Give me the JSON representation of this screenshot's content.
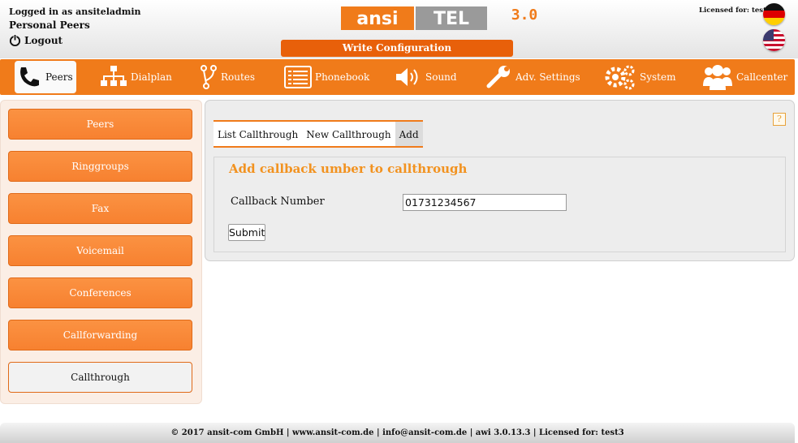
{
  "header": {
    "logged_in": "Logged in as ansiteladmin",
    "personal_peers": "Personal Peers",
    "logout": "Logout",
    "write_configuration": "Write Configuration",
    "licensed": "Licensed for: test3",
    "logo": {
      "part1": "ansi",
      "part2": "tel",
      "version": "3.0"
    },
    "flags": [
      "german-flag-icon",
      "us-flag-icon"
    ]
  },
  "nav": {
    "items": [
      {
        "label": "Peers",
        "icon": "phone-icon",
        "active": true
      },
      {
        "label": "Dialplan",
        "icon": "sitemap-icon"
      },
      {
        "label": "Routes",
        "icon": "routes-icon"
      },
      {
        "label": "Phonebook",
        "icon": "phonebook-icon"
      },
      {
        "label": "Sound",
        "icon": "speaker-icon"
      },
      {
        "label": "Adv. Settings",
        "icon": "wrench-icon"
      },
      {
        "label": "System",
        "icon": "gears-icon"
      },
      {
        "label": "Callcenter",
        "icon": "users-icon"
      }
    ]
  },
  "sidebar": {
    "items": [
      {
        "label": "Peers"
      },
      {
        "label": "Ringgroups"
      },
      {
        "label": "Fax"
      },
      {
        "label": "Voicemail"
      },
      {
        "label": "Conferences"
      },
      {
        "label": "Callforwarding"
      },
      {
        "label": "Callthrough",
        "active": true
      }
    ]
  },
  "main": {
    "help": "?",
    "tabs": [
      {
        "label": "List Callthrough"
      },
      {
        "label": "New Callthrough"
      },
      {
        "label": "Add",
        "active": true
      }
    ],
    "form": {
      "title": "Add callback umber to callthrough",
      "callback_label": "Callback Number",
      "callback_value": "01731234567",
      "submit": "Submit"
    }
  },
  "footer": {
    "text": "© 2017 ansit-com GmbH | www.ansit-com.de | info@ansit-com.de | awi 3.0.13.3 | Licensed for: test3"
  },
  "colors": {
    "accent": "#f07b1a",
    "title": "#f2921f",
    "write_config": "#e8600a"
  }
}
